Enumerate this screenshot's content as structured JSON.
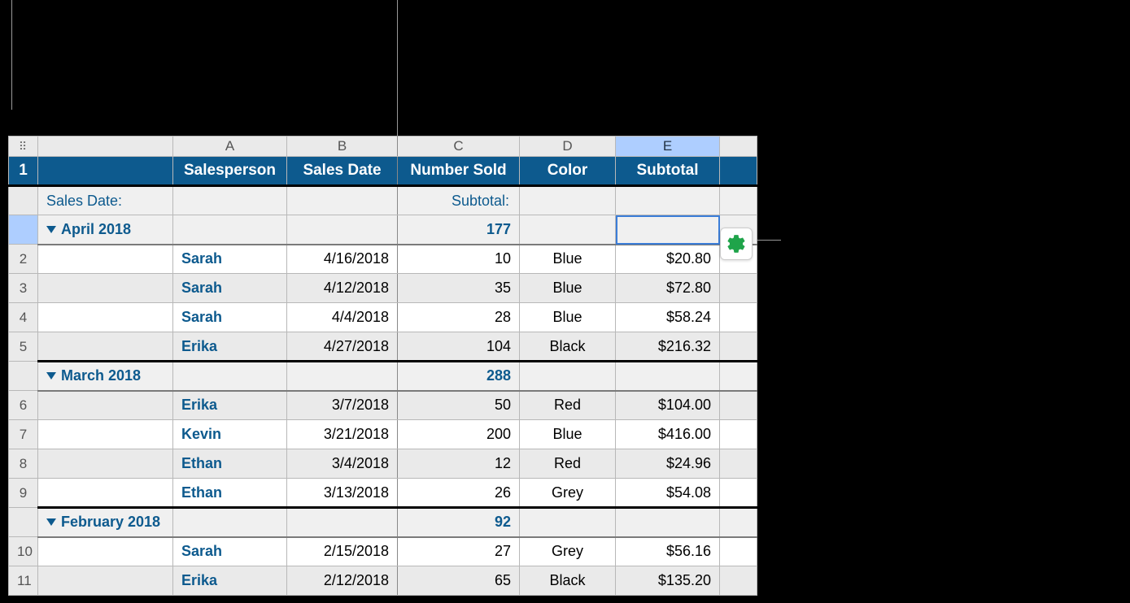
{
  "columns": {
    "A": "A",
    "B": "B",
    "C": "C",
    "D": "D",
    "E": "E"
  },
  "header": {
    "salesperson": "Salesperson",
    "salesDate": "Sales Date",
    "numberSold": "Number Sold",
    "color": "Color",
    "subtotal": "Subtotal"
  },
  "summary": {
    "salesDateLabel": "Sales Date:",
    "subtotalLabel": "Subtotal:"
  },
  "groups": [
    {
      "label": "April 2018",
      "numberSoldTotal": "177",
      "rows": [
        {
          "n": "2",
          "name": "Sarah",
          "date": "4/16/2018",
          "num": "10",
          "color": "Blue",
          "money": "$20.80"
        },
        {
          "n": "3",
          "name": "Sarah",
          "date": "4/12/2018",
          "num": "35",
          "color": "Blue",
          "money": "$72.80"
        },
        {
          "n": "4",
          "name": "Sarah",
          "date": "4/4/2018",
          "num": "28",
          "color": "Blue",
          "money": "$58.24"
        },
        {
          "n": "5",
          "name": "Erika",
          "date": "4/27/2018",
          "num": "104",
          "color": "Black",
          "money": "$216.32"
        }
      ]
    },
    {
      "label": "March 2018",
      "numberSoldTotal": "288",
      "rows": [
        {
          "n": "6",
          "name": "Erika",
          "date": "3/7/2018",
          "num": "50",
          "color": "Red",
          "money": "$104.00"
        },
        {
          "n": "7",
          "name": "Kevin",
          "date": "3/21/2018",
          "num": "200",
          "color": "Blue",
          "money": "$416.00"
        },
        {
          "n": "8",
          "name": "Ethan",
          "date": "3/4/2018",
          "num": "12",
          "color": "Red",
          "money": "$24.96"
        },
        {
          "n": "9",
          "name": "Ethan",
          "date": "3/13/2018",
          "num": "26",
          "color": "Grey",
          "money": "$54.08"
        }
      ]
    },
    {
      "label": "February 2018",
      "numberSoldTotal": "92",
      "rows": [
        {
          "n": "10",
          "name": "Sarah",
          "date": "2/15/2018",
          "num": "27",
          "color": "Grey",
          "money": "$56.16"
        },
        {
          "n": "11",
          "name": "Erika",
          "date": "2/12/2018",
          "num": "65",
          "color": "Black",
          "money": "$135.20"
        }
      ]
    }
  ],
  "rowNumbers": {
    "r1": "1"
  }
}
